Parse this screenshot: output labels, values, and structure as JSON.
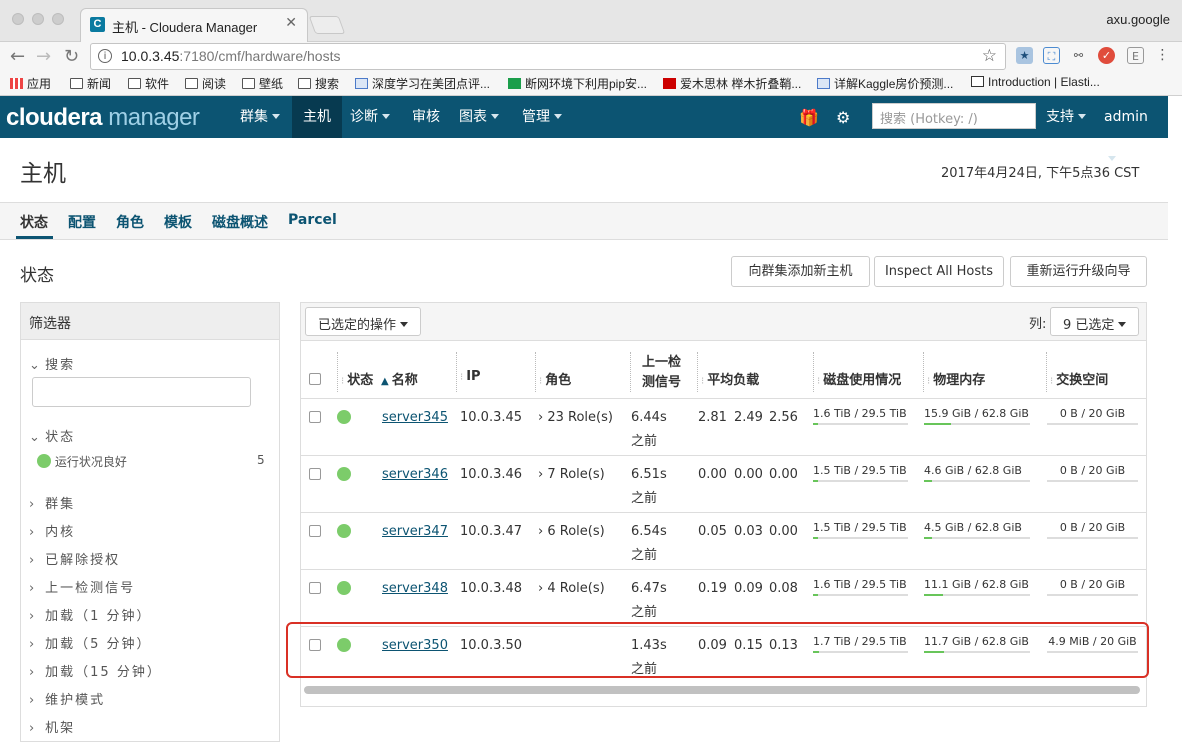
{
  "browser": {
    "tab_title": "主机 - Cloudera Manager",
    "tab_favicon": "C",
    "profile": "axu.google",
    "url_host": "10.0.3.45",
    "url_path": ":7180/cmf/hardware/hosts",
    "bookmarks": [
      "应用",
      "新闻",
      "软件",
      "阅读",
      "壁纸",
      "搜索",
      "深度学习在美团点评...",
      "断网环境下利用pip安...",
      "爱木思林 榉木折叠鞘...",
      "详解Kaggle房价预测...",
      "Introduction | Elasti..."
    ]
  },
  "header": {
    "logo_a": "cloudera",
    "logo_b": "manager",
    "menus": [
      "群集",
      "主机",
      "诊断",
      "审核",
      "图表",
      "管理"
    ],
    "search_placeholder": "搜索 (Hotkey: /)",
    "support": "支持",
    "user": "admin"
  },
  "page": {
    "title": "主机",
    "datetime": "2017年4月24日, 下午5点36 CST",
    "subnav": [
      "状态",
      "配置",
      "角色",
      "模板",
      "磁盘概述",
      "Parcel"
    ],
    "section": "状态",
    "buttons": [
      "向群集添加新主机",
      "Inspect All Hosts",
      "重新运行升级向导"
    ]
  },
  "filters": {
    "title": "筛选器",
    "search_label": "搜索",
    "status_label": "状态",
    "healthy_label": "运行状况良好",
    "healthy_count": "5",
    "groups": [
      "群集",
      "内核",
      "已解除授权",
      "上一检测信号",
      "加载（1 分钟）",
      "加载（5 分钟）",
      "加载（15 分钟）",
      "维护模式",
      "机架"
    ]
  },
  "table": {
    "actions_label": "已选定的操作",
    "cols_label": "列:",
    "cols_value": "9 已选定",
    "headers": [
      "状态",
      "名称",
      "IP",
      "角色",
      "上一检",
      "测信号",
      "平均负载",
      "磁盘使用情况",
      "物理内存",
      "交换空间"
    ],
    "rows": [
      {
        "name": "server345",
        "ip": "10.0.3.45",
        "roles": "23 Role(s)",
        "hb1": "6.44s",
        "hb2": "之前",
        "l1": "2.81",
        "l5": "2.49",
        "l15": "2.56",
        "disk": "1.6 TiB / 29.5 TiB",
        "disk_frac": 0.054,
        "mem": "15.9 GiB / 62.8 GiB",
        "mem_frac": 0.253,
        "swap": "0 B / 20 GiB",
        "swap_frac": 0
      },
      {
        "name": "server346",
        "ip": "10.0.3.46",
        "roles": "7 Role(s)",
        "hb1": "6.51s",
        "hb2": "之前",
        "l1": "0.00",
        "l5": "0.00",
        "l15": "0.00",
        "disk": "1.5 TiB / 29.5 TiB",
        "disk_frac": 0.051,
        "mem": "4.6 GiB / 62.8 GiB",
        "mem_frac": 0.073,
        "swap": "0 B / 20 GiB",
        "swap_frac": 0
      },
      {
        "name": "server347",
        "ip": "10.0.3.47",
        "roles": "6 Role(s)",
        "hb1": "6.54s",
        "hb2": "之前",
        "l1": "0.05",
        "l5": "0.03",
        "l15": "0.00",
        "disk": "1.5 TiB / 29.5 TiB",
        "disk_frac": 0.051,
        "mem": "4.5 GiB / 62.8 GiB",
        "mem_frac": 0.072,
        "swap": "0 B / 20 GiB",
        "swap_frac": 0
      },
      {
        "name": "server348",
        "ip": "10.0.3.48",
        "roles": "4 Role(s)",
        "hb1": "6.47s",
        "hb2": "之前",
        "l1": "0.19",
        "l5": "0.09",
        "l15": "0.08",
        "disk": "1.6 TiB / 29.5 TiB",
        "disk_frac": 0.054,
        "mem": "11.1 GiB / 62.8 GiB",
        "mem_frac": 0.177,
        "swap": "0 B / 20 GiB",
        "swap_frac": 0
      },
      {
        "name": "server350",
        "ip": "10.0.3.50",
        "roles": "",
        "hb1": "1.43s",
        "hb2": "之前",
        "l1": "0.09",
        "l5": "0.15",
        "l15": "0.13",
        "disk": "1.7 TiB / 29.5 TiB",
        "disk_frac": 0.058,
        "mem": "11.7 GiB / 62.8 GiB",
        "mem_frac": 0.186,
        "swap": "4.9 MiB / 20 GiB",
        "swap_frac": 0.0002
      }
    ]
  },
  "colors": {
    "brand": "#0c5472",
    "healthy": "#7ccc6a",
    "highlight": "#d93025"
  }
}
